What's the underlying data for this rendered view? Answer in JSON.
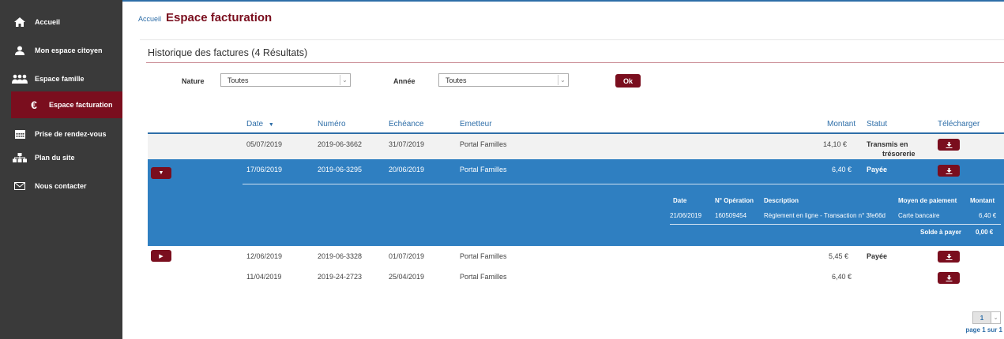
{
  "sidebar": {
    "items": [
      {
        "label": "Accueil",
        "icon": "home-icon"
      },
      {
        "label": "Mon espace citoyen",
        "icon": "user-icon"
      },
      {
        "label": "Espace famille",
        "icon": "family-icon"
      },
      {
        "label": "Espace facturation",
        "icon": "euro-icon",
        "active": true
      },
      {
        "label": "Prise de rendez-vous",
        "icon": "calendar-icon"
      },
      {
        "label": "Plan du site",
        "icon": "sitemap-icon"
      },
      {
        "label": "Nous contacter",
        "icon": "envelope-icon"
      }
    ]
  },
  "breadcrumb": {
    "home": "Accueil"
  },
  "page": {
    "title": "Espace facturation"
  },
  "panel": {
    "title": "Historique des factures (4 Résultats)"
  },
  "filters": {
    "nature_label": "Nature",
    "nature_value": "Toutes",
    "annee_label": "Année",
    "annee_value": "Toutes",
    "ok_label": "Ok"
  },
  "table": {
    "headers": {
      "date": "Date",
      "numero": "Numéro",
      "echeance": "Echéance",
      "emetteur": "Emetteur",
      "montant": "Montant",
      "statut": "Statut",
      "telecharger": "Télécharger"
    },
    "rows": [
      {
        "date": "05/07/2019",
        "numero": "2019-06-3662",
        "echeance": "31/07/2019",
        "emetteur": "Portal Familles",
        "montant": "14,10 €",
        "statut_1": "Transmis en",
        "statut_2": "trésorerie"
      },
      {
        "date": "17/06/2019",
        "numero": "2019-06-3295",
        "echeance": "20/06/2019",
        "emetteur": "Portal Familles",
        "montant": "6,40 €",
        "statut_1": "Payée",
        "statut_2": ""
      },
      {
        "date": "12/06/2019",
        "numero": "2019-06-3328",
        "echeance": "01/07/2019",
        "emetteur": "Portal Familles",
        "montant": "5,45 €",
        "statut_1": "Payée",
        "statut_2": ""
      },
      {
        "date": "11/04/2019",
        "numero": "2019-24-2723",
        "echeance": "25/04/2019",
        "emetteur": "Portal Familles",
        "montant": "6,40 €",
        "statut_1": "",
        "statut_2": ""
      }
    ]
  },
  "detail": {
    "headers": {
      "date": "Date",
      "operation": "N° Opération",
      "description": "Description",
      "moyen": "Moyen de paiement",
      "montant": "Montant"
    },
    "row": {
      "date": "21/06/2019",
      "operation": "160509454",
      "description": "Règlement en ligne - Transaction n° 3fe66d",
      "moyen": "Carte bancaire",
      "montant": "6,40 €"
    },
    "solde_label": "Solde à payer",
    "solde_value": "0,00 €"
  },
  "pagination": {
    "current": "1",
    "info": "page 1 sur 1"
  },
  "colors": {
    "accent": "#7a0e1e",
    "primary_blue": "#2e6ea8",
    "selected_row": "#2f7fc1",
    "sidebar_bg": "#3a3a3a"
  }
}
